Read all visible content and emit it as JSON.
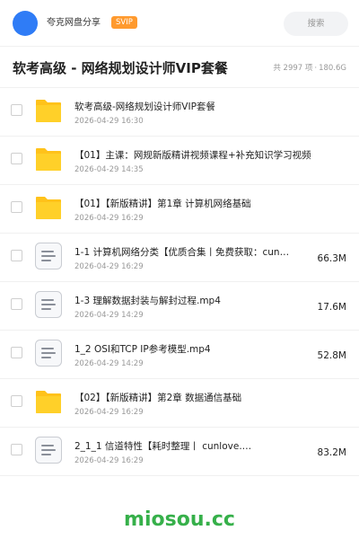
{
  "header": {
    "user_name": "夸克网盘分享",
    "badge": "SVIP",
    "search_label": "搜索"
  },
  "page": {
    "title": "软考高级 - 网络规划设计师VIP套餐",
    "item_count": "共 2997 项",
    "separator": "·",
    "total_size": "180.6G"
  },
  "files": [
    {
      "type": "folder",
      "name": "软考高级-网络规划设计师VIP套餐",
      "date": "2026-04-29 16:30",
      "size": ""
    },
    {
      "type": "folder",
      "name": "【01】主课：网规新版精讲视频课程+补充知识学习视频",
      "date": "2026-04-29 14:35",
      "size": ""
    },
    {
      "type": "folder",
      "name": "【01】【新版精讲】第1章 计算机网络基础",
      "date": "2026-04-29 16:29",
      "size": ""
    },
    {
      "type": "file",
      "name": "1-1 计算机网络分类【优质合集丨免费获取：cun…",
      "date": "2026-04-29 16:29",
      "size": "66.3M"
    },
    {
      "type": "file",
      "name": "1-3 理解数据封装与解封过程.mp4",
      "date": "2026-04-29 14:29",
      "size": "17.6M"
    },
    {
      "type": "file",
      "name": "1_2 OSI和TCP IP参考模型.mp4",
      "date": "2026-04-29 14:29",
      "size": "52.8M"
    },
    {
      "type": "folder",
      "name": "【02】【新版精讲】第2章 数据通信基础",
      "date": "2026-04-29 16:29",
      "size": ""
    },
    {
      "type": "file",
      "name": "2_1_1 信道特性【耗时整理丨 cunlove.…",
      "date": "2026-04-29 16:29",
      "size": "83.2M"
    }
  ],
  "watermark": "miosou.cc",
  "colors": {
    "accent": "#2f7cf6",
    "badge": "#ff9a2e",
    "folder": "#ffc21a",
    "watermark": "#36b04a"
  }
}
